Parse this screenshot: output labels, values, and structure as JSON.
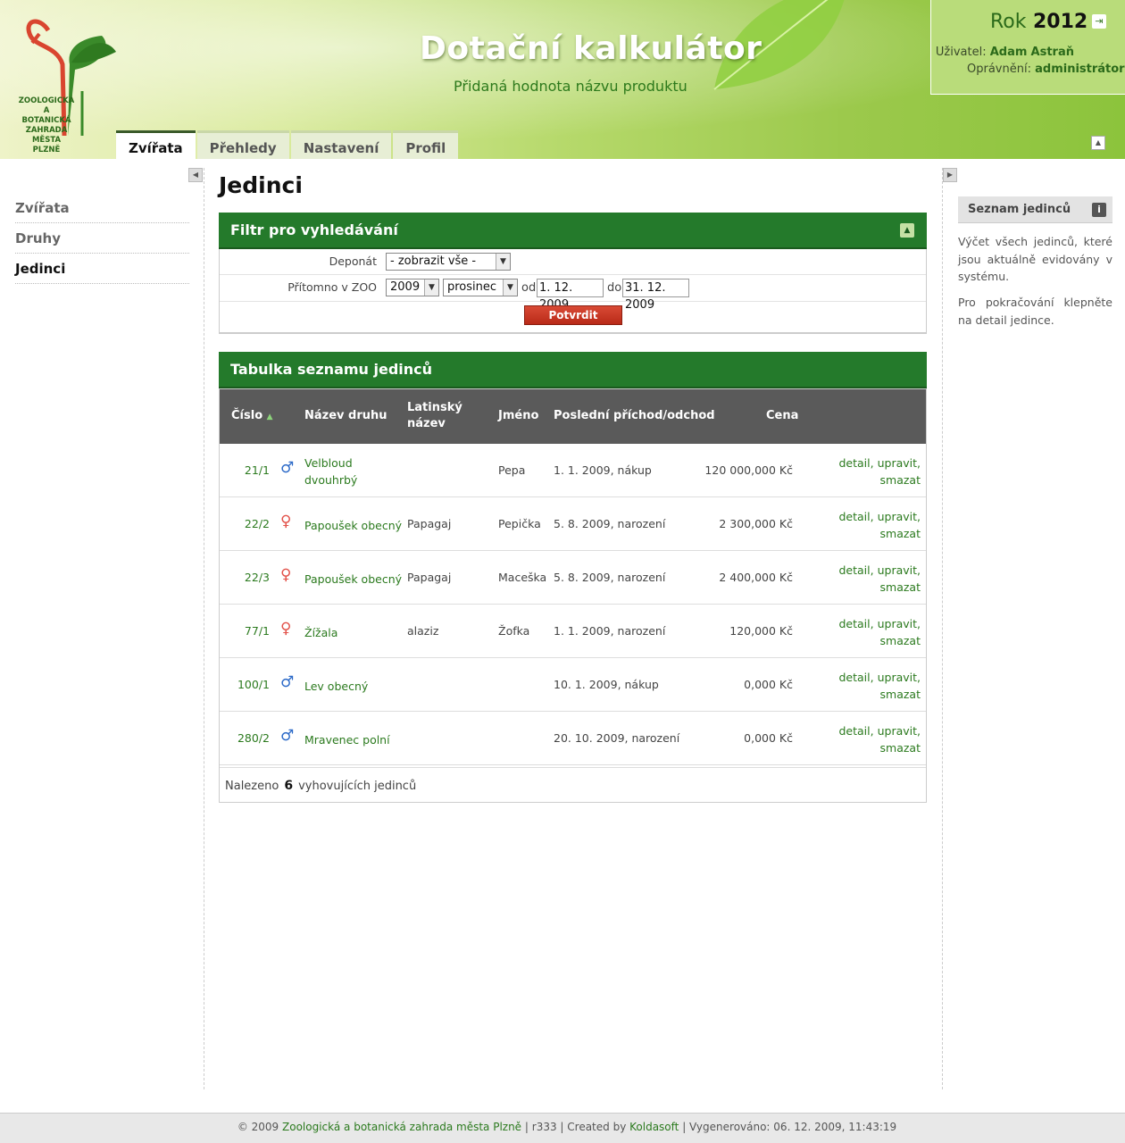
{
  "header": {
    "logo_text": [
      "ZOOLOGICKÁ",
      "A BOTANICKÁ",
      "ZAHRADA",
      "MĚSTA PLZNĚ"
    ],
    "title": "Dotační kalkulátor",
    "subtitle": "Přidaná hodnota názvu produktu",
    "year_label": "Rok",
    "year_value": "2012",
    "user_label": "Uživatel:",
    "user_name": "Adam",
    "user_surname": "Astraň",
    "perm_label": "Oprávnění:",
    "perm_value": "administrátor",
    "logout_icon": "logout-icon",
    "collapse_icon": "chevron-up-icon"
  },
  "tabs": [
    {
      "label": "Zvířata",
      "active": true
    },
    {
      "label": "Přehledy"
    },
    {
      "label": "Nastavení"
    },
    {
      "label": "Profil"
    }
  ],
  "left_nav": [
    {
      "label": "Zvířata"
    },
    {
      "label": "Druhy"
    },
    {
      "label": "Jedinci",
      "active": true
    }
  ],
  "main": {
    "title": "Jedinci",
    "filter": {
      "title": "Filtr pro vyhledávání",
      "deponat_label": "Deponát",
      "deponat_value": "- zobrazit vše -",
      "present_label": "Přítomno v ZOO",
      "year_value": "2009",
      "month_value": "prosinec",
      "from_label": "od",
      "from_value": "1. 12. 2009",
      "to_label": "do",
      "to_value": "31. 12. 2009",
      "submit_label": "Potvrdit"
    },
    "table": {
      "title": "Tabulka seznamu jedinců",
      "columns": {
        "number": "Číslo",
        "species": "Název druhu",
        "latin_1": "Latinský",
        "latin_2": "název",
        "name": "Jméno",
        "last_move": "Poslední příchod/odchod",
        "price": "Cena"
      },
      "rows": [
        {
          "number": "21/1",
          "sex": "♂",
          "sex_class": "male",
          "species_1": "Velbloud",
          "species_2": "dvouhrbý",
          "latin": "",
          "name": "Pepa",
          "last_move": "1. 1. 2009, nákup",
          "price": "120 000,000 Kč"
        },
        {
          "number": "22/2",
          "sex": "♀",
          "sex_class": "female",
          "species_1": "Papoušek obecný",
          "species_2": "",
          "latin": "Papagaj",
          "name": "Pepička",
          "last_move": "5. 8. 2009, narození",
          "price": "2 300,000 Kč"
        },
        {
          "number": "22/3",
          "sex": "♀",
          "sex_class": "female",
          "species_1": "Papoušek obecný",
          "species_2": "",
          "latin": "Papagaj",
          "name": "Maceška",
          "last_move": "5. 8. 2009, narození",
          "price": "2 400,000 Kč"
        },
        {
          "number": "77/1",
          "sex": "♀",
          "sex_class": "female",
          "species_1": "Žížala",
          "species_2": "",
          "latin": "alaziz",
          "name": "Žofka",
          "last_move": "1. 1. 2009, narození",
          "price": "120,000 Kč"
        },
        {
          "number": "100/1",
          "sex": "♂",
          "sex_class": "male",
          "species_1": "Lev obecný",
          "species_2": "",
          "latin": "",
          "name": "",
          "last_move": "10. 1. 2009, nákup",
          "price": "0,000 Kč"
        },
        {
          "number": "280/2",
          "sex": "♂",
          "sex_class": "male",
          "species_1": "Mravenec polní",
          "species_2": "",
          "latin": "",
          "name": "",
          "last_move": "20. 10. 2009, narození",
          "price": "0,000 Kč"
        }
      ],
      "actions": {
        "detail": "detail,",
        "edit": "upravit,",
        "delete": "smazat"
      },
      "footer_prefix": "Nalezeno",
      "footer_count": "6",
      "footer_suffix": "vyhovujících jedinců"
    }
  },
  "info": {
    "title": "Seznam jedinců",
    "paragraph_1": "Výčet všech jedinců, které jsou aktuálně evidovány v systému.",
    "paragraph_2": "Pro pokračování klepněte na detail jedince."
  },
  "footer": {
    "copyright": "© 2009",
    "org_link": "Zoologická a botanická zahrada města Plzně",
    "revision": "| r333 | Created by",
    "vendor_link": "Koldasoft",
    "generated": "| Vygenerováno: 06. 12. 2009, 11:43:19"
  },
  "colors": {
    "primary_green": "#247a2b",
    "link_green": "#2b7a1e",
    "button_red": "#c43a25",
    "male_blue": "#2c6ac8",
    "female_red": "#e2524a"
  }
}
